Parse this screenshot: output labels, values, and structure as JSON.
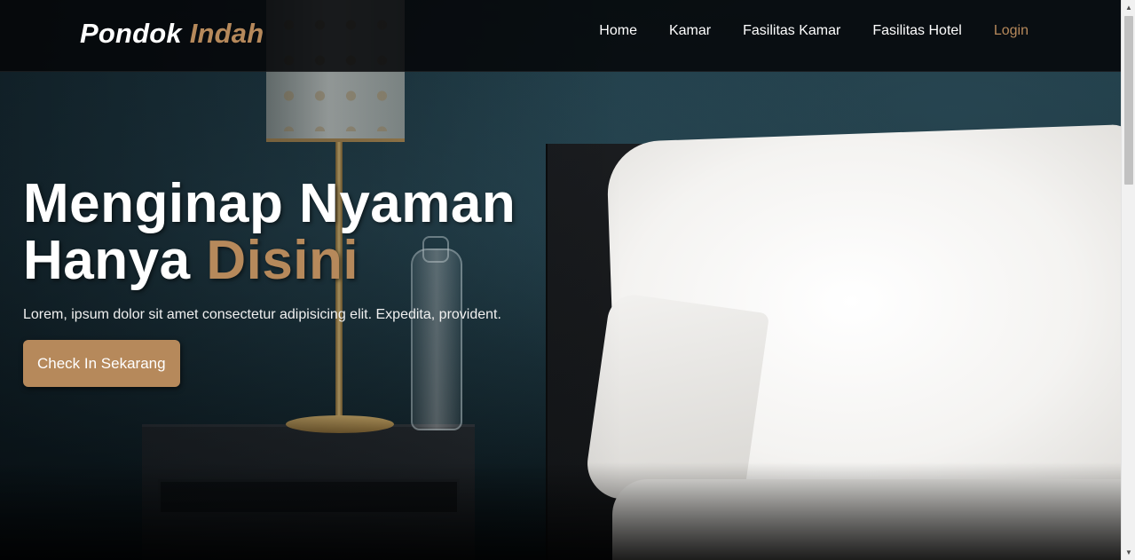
{
  "navbar": {
    "brand_main": "Pondok",
    "brand_accent": "Indah",
    "links": [
      {
        "label": "Home"
      },
      {
        "label": "Kamar"
      },
      {
        "label": "Fasilitas Kamar"
      },
      {
        "label": "Fasilitas Hotel"
      },
      {
        "label": "Login"
      }
    ]
  },
  "hero": {
    "title_line1": "Menginap Nyaman",
    "title_line2_main": "Hanya",
    "title_line2_accent": "Disini",
    "subtitle": "Lorem, ipsum dolor sit amet consectetur adipisicing elit. Expedita, provident.",
    "cta_label": "Check In Sekarang"
  },
  "colors": {
    "accent": "#b6895b",
    "navbar_bg": "#050608",
    "text": "#ffffff"
  },
  "icons": {
    "scroll_up": "triangle-up-icon",
    "scroll_down": "triangle-down-icon"
  }
}
